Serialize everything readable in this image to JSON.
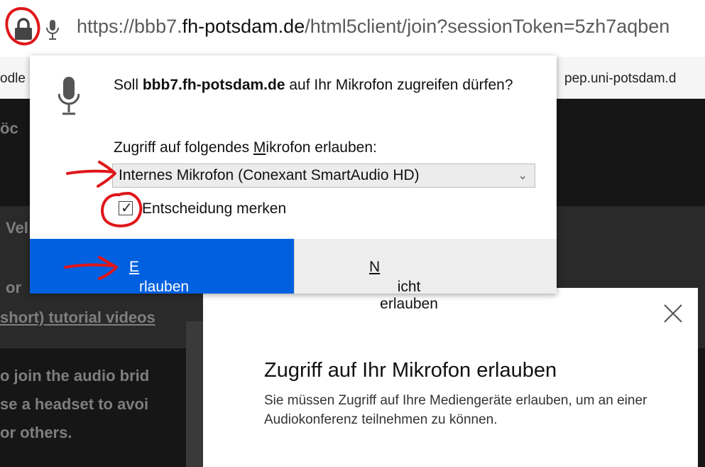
{
  "url": {
    "prefix": "https://bbb7.",
    "host": "fh-potsdam.de",
    "path": "/html5client/join?sessionToken=5zh7aqben"
  },
  "bookmarks": {
    "left": "odle",
    "right": "pep.uni-potsdam.d"
  },
  "background": {
    "line_a": "öc",
    "line_b": "Vel",
    "line_c": "or",
    "line_d": "short) tutorial videos",
    "line_e": "o join the audio brid",
    "line_f": "se a headset to avoi",
    "line_g": "or others."
  },
  "popup": {
    "question_pre": "Soll ",
    "question_host": "bbb7.fh-potsdam.de",
    "question_post": " auf Ihr Mikrofon zugreifen dürfen?",
    "select_label_pre": "Zugriff auf folgendes ",
    "select_label_mn": "M",
    "select_label_post": "ikrofon erlauben:",
    "select_value": "Internes Mikrofon (Conexant SmartAudio HD)",
    "checkbox_checked": true,
    "checkbox_label": "Entscheidung merken",
    "allow_mn": "E",
    "allow_rest": "rlauben",
    "deny_mn": "N",
    "deny_rest": "icht erlauben"
  },
  "modal": {
    "title": "Zugriff auf Ihr Mikrofon erlauben",
    "description": "Sie müssen Zugriff auf Ihre Mediengeräte erlauben, um an einer Audiokonferenz teilnehmen zu können."
  },
  "colors": {
    "accent": "#0060df",
    "annotation": "#e0161a"
  }
}
